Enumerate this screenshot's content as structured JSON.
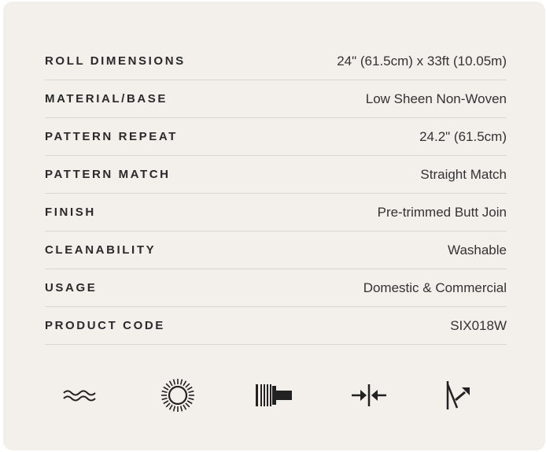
{
  "specs": [
    {
      "label": "ROLL DIMENSIONS",
      "value": "24\" (61.5cm) x 33ft (10.05m)"
    },
    {
      "label": "MATERIAL/BASE",
      "value": "Low Sheen Non-Woven"
    },
    {
      "label": "PATTERN REPEAT",
      "value": "24.2\" (61.5cm)"
    },
    {
      "label": "PATTERN MATCH",
      "value": "Straight Match"
    },
    {
      "label": "FINISH",
      "value": "Pre-trimmed Butt Join"
    },
    {
      "label": "CLEANABILITY",
      "value": "Washable"
    },
    {
      "label": "USAGE",
      "value": "Domestic & Commercial"
    },
    {
      "label": "PRODUCT CODE",
      "value": "SIX018W"
    }
  ],
  "care_icons": [
    "washable-icon",
    "light-fastness-icon",
    "paste-the-wall-icon",
    "butt-join-icon",
    "peelable-icon"
  ],
  "colors": {
    "card_background": "#f3efeb",
    "divider": "#ddd6cf",
    "text": "#2a2a2a"
  }
}
